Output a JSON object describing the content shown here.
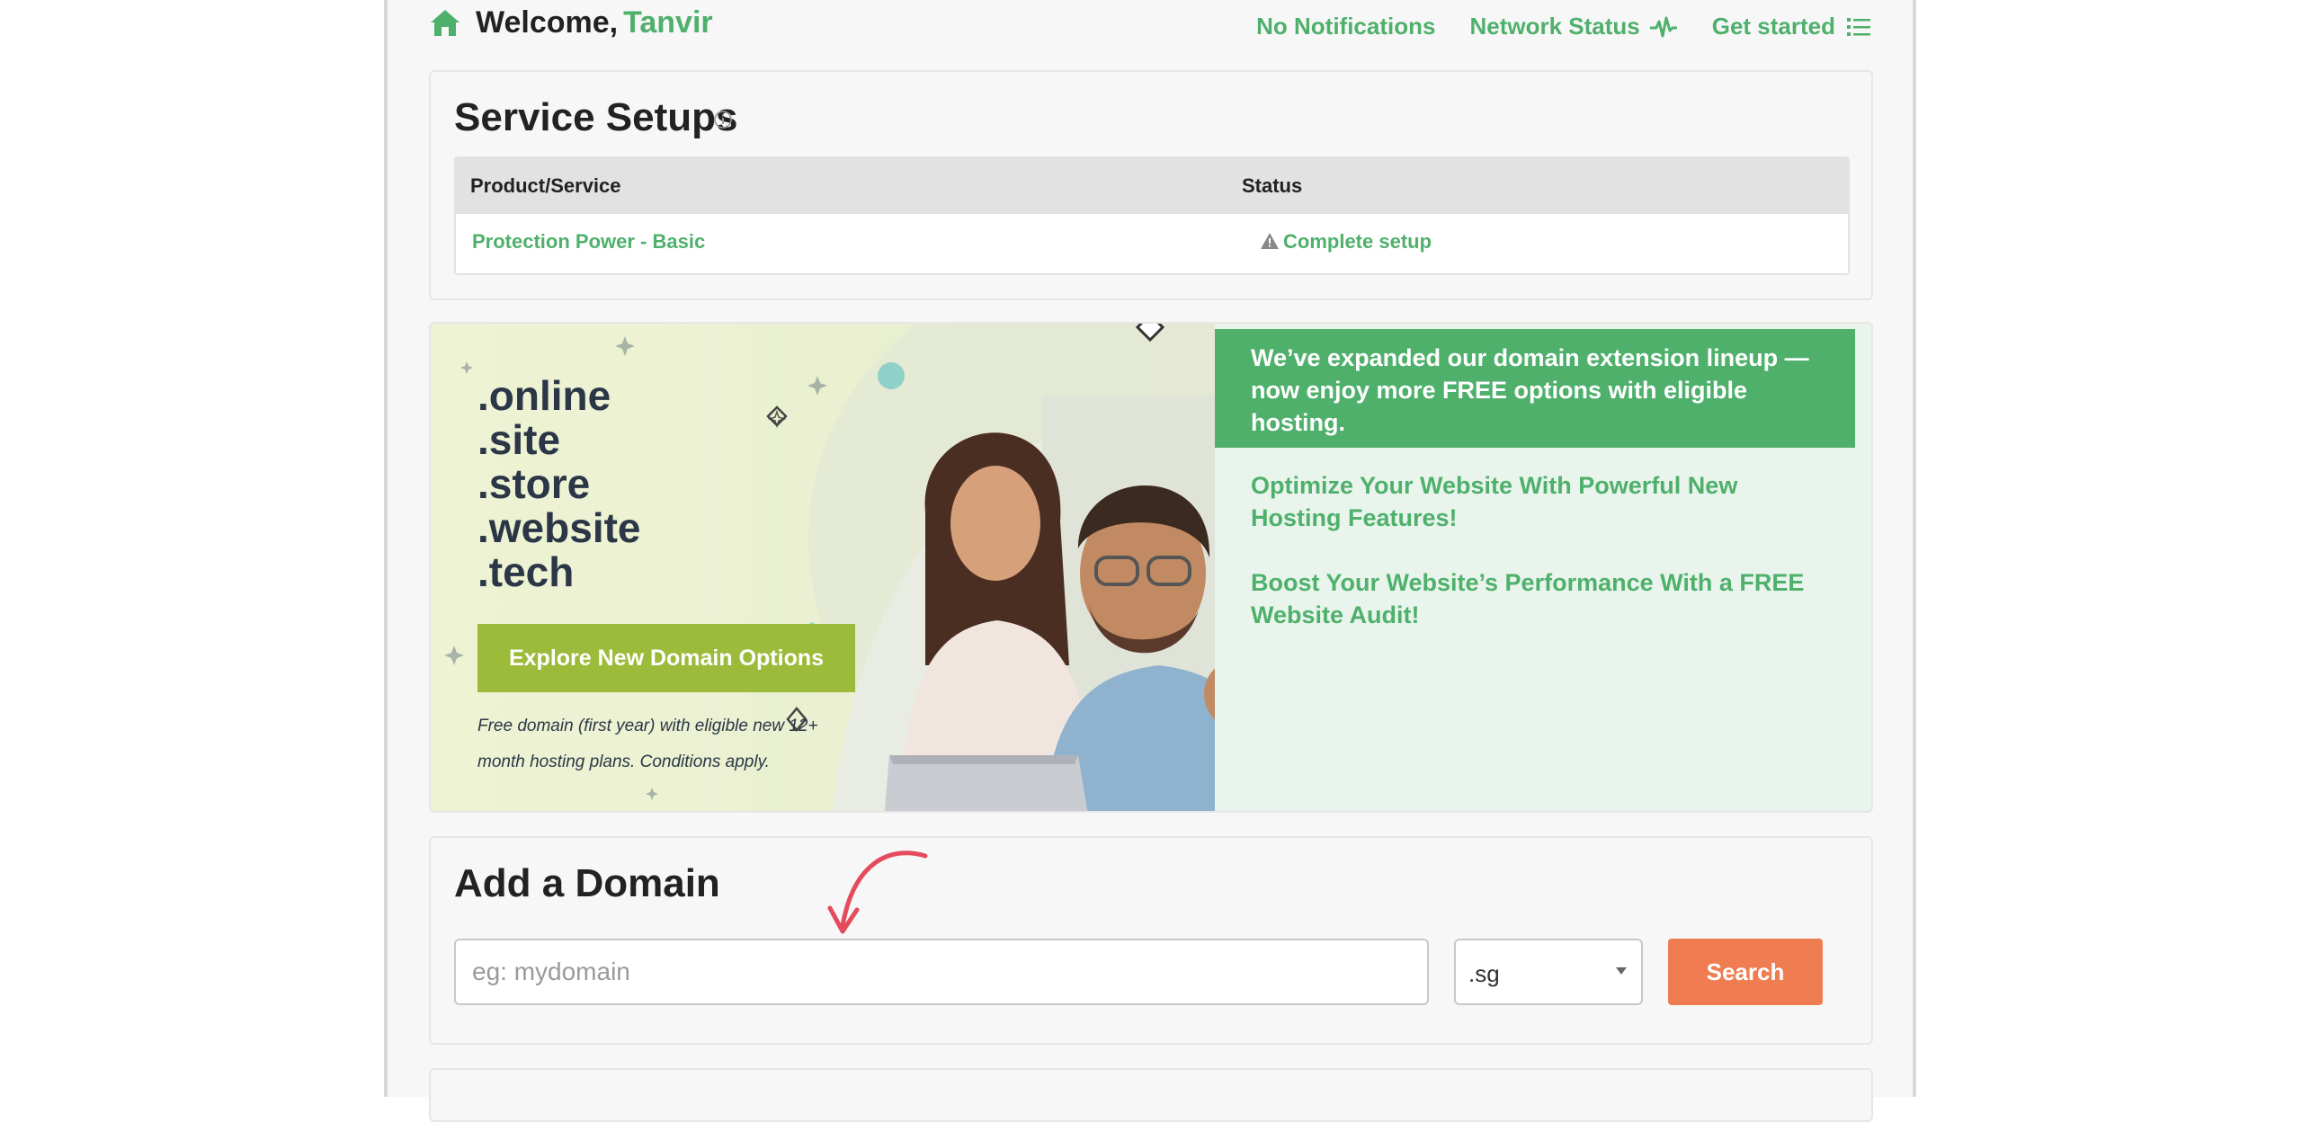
{
  "header": {
    "welcome": "Welcome,",
    "user_name": "Tanvir",
    "links": [
      {
        "label": "No Notifications"
      },
      {
        "label": "Network Status",
        "icon": "pulse-icon"
      },
      {
        "label": "Get started",
        "icon": "list-icon"
      }
    ]
  },
  "services": {
    "title": "Service Setups",
    "columns": [
      "Product/Service",
      "Status"
    ],
    "rows": [
      {
        "product": "Protection Power - Basic",
        "status": "Complete setup",
        "status_icon": "warning-icon"
      }
    ]
  },
  "promo": {
    "tlds": [
      ".online",
      ".site",
      ".store",
      ".website",
      ".tech"
    ],
    "cta": "Explore New Domain Options",
    "disclaimer": "Free domain (first year) with eligible new 12+ month hosting plans. Conditions apply.",
    "highlight": "We’ve expanded our domain extension lineup — now enjoy more FREE options with eligible hosting.",
    "links": [
      "Optimize Your Website With Powerful New Hosting Features!",
      "Boost Your Website’s Performance With a FREE Website Audit!"
    ]
  },
  "add_domain": {
    "title": "Add a Domain",
    "input_placeholder": "eg: mydomain",
    "tld_selected": ".sg",
    "search_label": "Search"
  },
  "colors": {
    "accent": "#4fb06c",
    "cta_green": "#9dbb3a",
    "search_orange": "#f07d52",
    "text_dark": "#222222"
  }
}
